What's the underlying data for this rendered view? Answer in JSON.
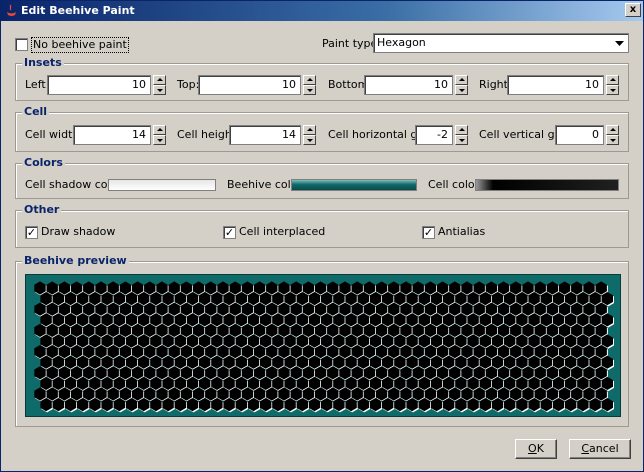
{
  "window": {
    "title": "Edit Beehive Paint",
    "close_label": "x"
  },
  "top": {
    "no_paint_label": "No beehive paint",
    "no_paint_checked": false,
    "paint_type_label": "Paint type:",
    "paint_type_value": "Hexagon"
  },
  "insets": {
    "title": "Insets",
    "left_label": "Left:",
    "left_value": "10",
    "top_label": "Top:",
    "top_value": "10",
    "bottom_label": "Bottom:",
    "bottom_value": "10",
    "right_label": "Right:",
    "right_value": "10"
  },
  "cell": {
    "title": "Cell",
    "width_label": "Cell width:",
    "width_value": "14",
    "height_label": "Cell height:",
    "height_value": "14",
    "hgap_label": "Cell horizontal gap:",
    "hgap_value": "-2",
    "vgap_label": "Cell vertical gap:",
    "vgap_value": "0"
  },
  "colors": {
    "title": "Colors",
    "shadow_label": "Cell shadow color:",
    "beehive_label": "Beehive color:",
    "cell_label": "Cell color:",
    "shadow_color": "#ffffff",
    "beehive_color": "#0f6a6a",
    "cell_color": "#000000"
  },
  "other": {
    "title": "Other",
    "draw_shadow_label": "Draw shadow",
    "draw_shadow_checked": true,
    "interplaced_label": "Cell interplaced",
    "interplaced_checked": true,
    "antialias_label": "Antialias",
    "antialias_checked": true
  },
  "preview": {
    "title": "Beehive preview"
  },
  "buttons": {
    "ok_mnemonic": "O",
    "ok_rest": "K",
    "cancel_mnemonic": "C",
    "cancel_rest": "ancel"
  }
}
